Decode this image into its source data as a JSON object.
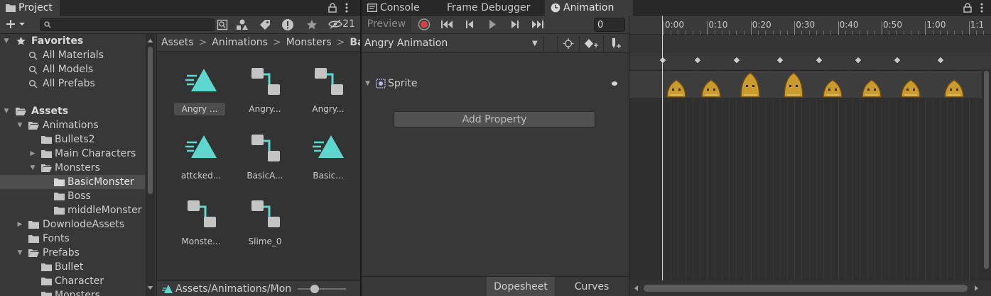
{
  "project": {
    "tab_label": "Project",
    "search_placeholder": "",
    "hidden_count": "21",
    "tree": {
      "favorites": "Favorites",
      "all_materials": "All Materials",
      "all_models": "All Models",
      "all_prefabs": "All Prefabs",
      "assets": "Assets",
      "animations": "Animations",
      "bullets2": "Bullets2",
      "main_characters": "Main Characters",
      "monsters": "Monsters",
      "basic_monster": "BasicMonster",
      "boss": "Boss",
      "middle_monster": "middleMonster",
      "downlode_assets": "DownlodeAssets",
      "fonts": "Fonts",
      "prefabs": "Prefabs",
      "bullet": "Bullet",
      "character": "Character",
      "monsters_prefab": "Monsters"
    },
    "breadcrumb": [
      "Assets",
      "Animations",
      "Monsters",
      "Ba"
    ],
    "assets": [
      {
        "label": "Angry ...",
        "kind": "clip"
      },
      {
        "label": "Angry...",
        "kind": "controller"
      },
      {
        "label": "Angry...",
        "kind": "controller"
      },
      {
        "label": "attcked...",
        "kind": "clip"
      },
      {
        "label": "BasicA...",
        "kind": "controller"
      },
      {
        "label": "Basic...",
        "kind": "clip"
      },
      {
        "label": "Monste...",
        "kind": "controller"
      },
      {
        "label": "Slime_0",
        "kind": "controller"
      }
    ],
    "status_path": "Assets/Animations/Mon",
    "icon_size_level": 0.35
  },
  "tabs": {
    "console": "Console",
    "frame_debugger": "Frame Debugger",
    "animation": "Animation"
  },
  "animation": {
    "preview_label": "Preview",
    "frame_value": "0",
    "clip_name": "Angry Animation",
    "property_name": "Sprite",
    "add_property": "Add Property",
    "dopesheet": "Dopesheet",
    "curves": "Curves",
    "ruler_labels": [
      "0:00",
      "0:10",
      "0:20",
      "0:30",
      "0:40",
      "0:50",
      "1:00",
      "1:1"
    ]
  },
  "colors": {
    "accent_teal": "#5ed8cf",
    "controller_gray": "#c4c4c4",
    "record_red": "#d0463f",
    "sprite_gold": "#c99a2e"
  }
}
